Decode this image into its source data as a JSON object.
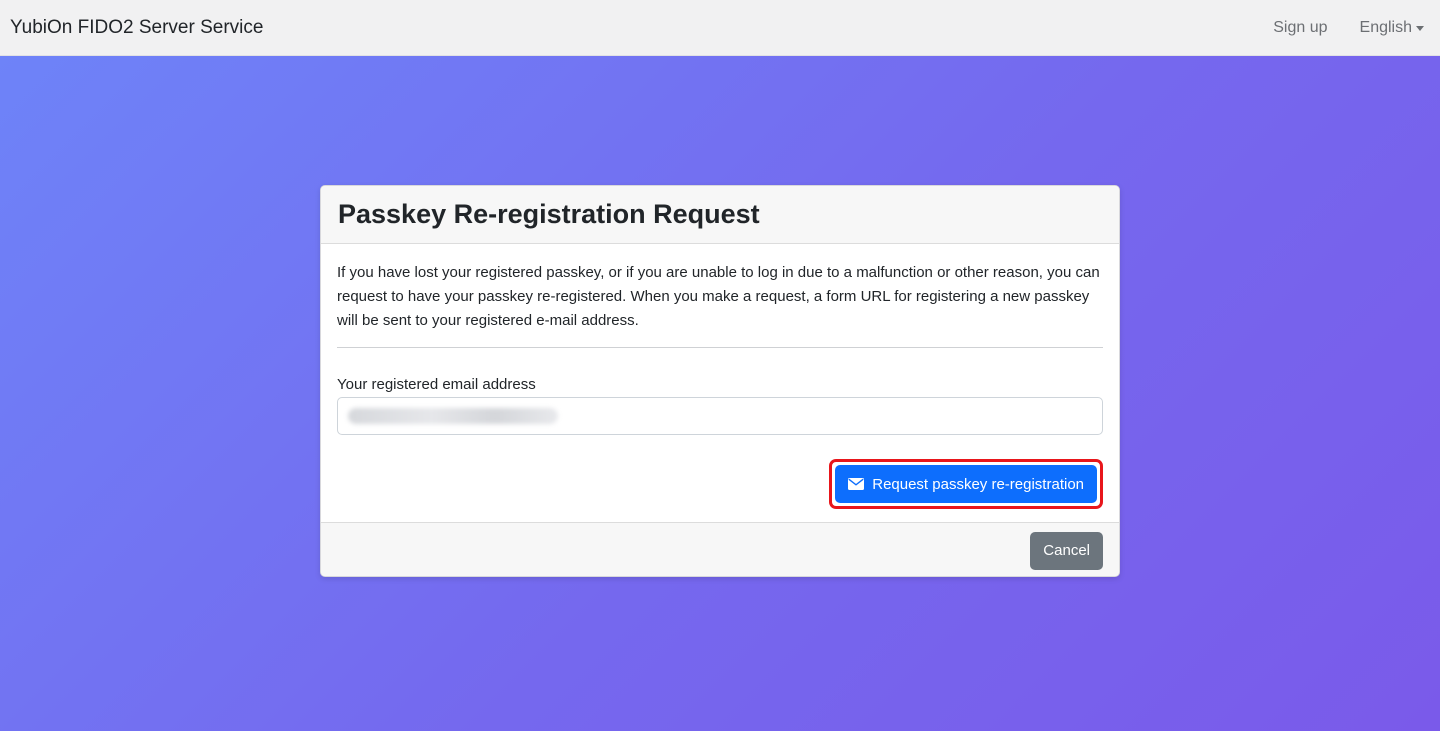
{
  "navbar": {
    "brand": "YubiOn FIDO2 Server Service",
    "signup_label": "Sign up",
    "language_label": "English"
  },
  "card": {
    "title": "Passkey Re-registration Request",
    "description": "If you have lost your registered passkey, or if you are unable to log in due to a malfunction or other reason, you can request to have your passkey re-registered. When you make a request, a form URL for registering a new passkey will be sent to your registered e-mail address.",
    "email_label": "Your registered email address",
    "request_button_label": "Request passkey re-registration",
    "cancel_button_label": "Cancel"
  },
  "colors": {
    "primary": "#0d6efd",
    "secondary": "#6c757d",
    "highlight": "#e8161b"
  },
  "icons": {
    "request_button": "envelope-icon",
    "language_dropdown": "caret-down-icon"
  }
}
